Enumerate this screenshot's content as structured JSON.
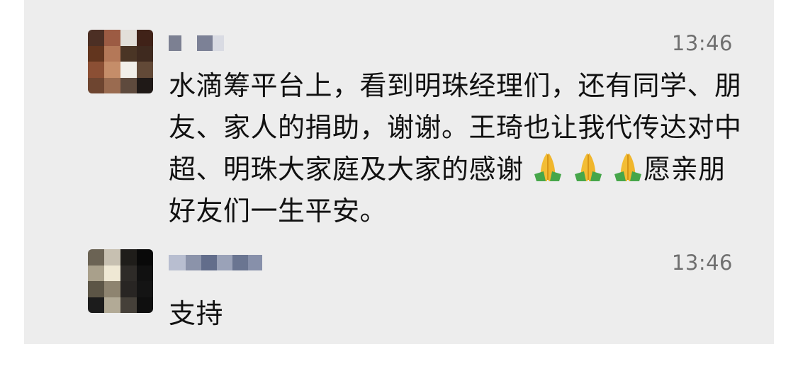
{
  "messages": [
    {
      "time": "13:46",
      "text_parts": [
        "水滴筹平台上，看到明珠经理们，还有同学、朋友、家人的捐助，谢谢。王琦也让我代传达对中超、明珠大家庭及大家的感谢",
        "愿亲朋好友们一生平安。"
      ],
      "emoji": "folded-hands-emoji"
    },
    {
      "time": "13:46",
      "text": "支持"
    }
  ],
  "colors": {
    "panel_background": "#ededed",
    "page_background": "#ffffff",
    "message_text": "#111111",
    "timestamp_text": "#6f6f6f"
  }
}
